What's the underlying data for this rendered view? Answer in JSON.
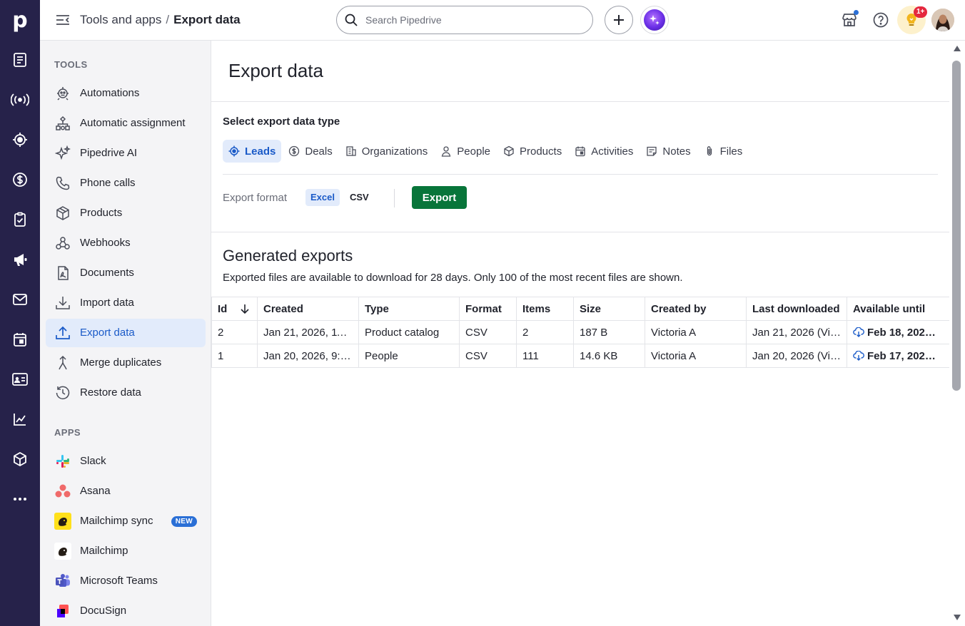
{
  "app": {
    "logo_letter": "p",
    "brand_color": "#26224a",
    "accent_color": "#1a5ac8",
    "export_button_color": "#08753a"
  },
  "rail": {
    "icons": [
      "leads-inbox-icon",
      "live-signal-icon",
      "target-icon",
      "deals-dollar-icon",
      "projects-clipboard-icon",
      "campaigns-megaphone-icon",
      "mail-icon",
      "calendar-icon",
      "contacts-card-icon",
      "insights-chart-icon",
      "products-box-icon",
      "more-dots-icon"
    ]
  },
  "header": {
    "breadcrumb_parent": "Tools and apps",
    "breadcrumb_separator": "/",
    "breadcrumb_current": "Export data",
    "search_placeholder": "Search Pipedrive",
    "notifications_badge": "1+"
  },
  "sidebar": {
    "tools_heading": "TOOLS",
    "tools": [
      {
        "label": "Automations",
        "icon": "automation-robot-icon"
      },
      {
        "label": "Automatic assignment",
        "icon": "assignment-tree-icon"
      },
      {
        "label": "Pipedrive AI",
        "icon": "sparkle-icon"
      },
      {
        "label": "Phone calls",
        "icon": "phone-icon"
      },
      {
        "label": "Products",
        "icon": "box-icon"
      },
      {
        "label": "Webhooks",
        "icon": "webhook-icon"
      },
      {
        "label": "Documents",
        "icon": "document-icon"
      },
      {
        "label": "Import data",
        "icon": "download-icon"
      },
      {
        "label": "Export data",
        "icon": "upload-icon"
      },
      {
        "label": "Merge duplicates",
        "icon": "merge-icon"
      },
      {
        "label": "Restore data",
        "icon": "restore-icon"
      }
    ],
    "apps_heading": "APPS",
    "apps": [
      {
        "label": "Slack",
        "icon": "slack-logo-icon"
      },
      {
        "label": "Asana",
        "icon": "asana-logo-icon"
      },
      {
        "label": "Mailchimp sync",
        "icon": "mailchimp-logo-icon",
        "badge": "NEW"
      },
      {
        "label": "Mailchimp",
        "icon": "mailchimp-mono-icon"
      },
      {
        "label": "Microsoft Teams",
        "icon": "teams-logo-icon"
      },
      {
        "label": "DocuSign",
        "icon": "docusign-logo-icon"
      }
    ]
  },
  "main": {
    "title": "Export data",
    "select_label": "Select export data type",
    "types": [
      {
        "label": "Leads",
        "icon": "target-icon",
        "active": true
      },
      {
        "label": "Deals",
        "icon": "dollar-icon"
      },
      {
        "label": "Organizations",
        "icon": "building-icon"
      },
      {
        "label": "People",
        "icon": "person-icon"
      },
      {
        "label": "Products",
        "icon": "box-icon"
      },
      {
        "label": "Activities",
        "icon": "calendar-icon"
      },
      {
        "label": "Notes",
        "icon": "note-icon"
      },
      {
        "label": "Files",
        "icon": "paperclip-icon"
      }
    ],
    "format_label": "Export format",
    "format_options": [
      "Excel",
      "CSV"
    ],
    "format_selected": "Excel",
    "export_button": "Export",
    "generated_title": "Generated exports",
    "generated_subtitle": "Exported files are available to download for 28 days. Only 100 of the most recent files are shown.",
    "table": {
      "columns": [
        "Id",
        "Created",
        "Type",
        "Format",
        "Items",
        "Size",
        "Created by",
        "Last downloaded",
        "Available until"
      ],
      "rows": [
        [
          "2",
          "Jan 21, 2026, 11:…",
          "Product catalog",
          "CSV",
          "2",
          "187 B",
          "Victoria A",
          "Jan 21, 2026 (Vi…",
          "Feb 18, 202…"
        ],
        [
          "1",
          "Jan 20, 2026, 9:…",
          "People",
          "CSV",
          "111",
          "14.6 KB",
          "Victoria A",
          "Jan 20, 2026 (Vi…",
          "Feb 17, 202…"
        ]
      ]
    }
  }
}
